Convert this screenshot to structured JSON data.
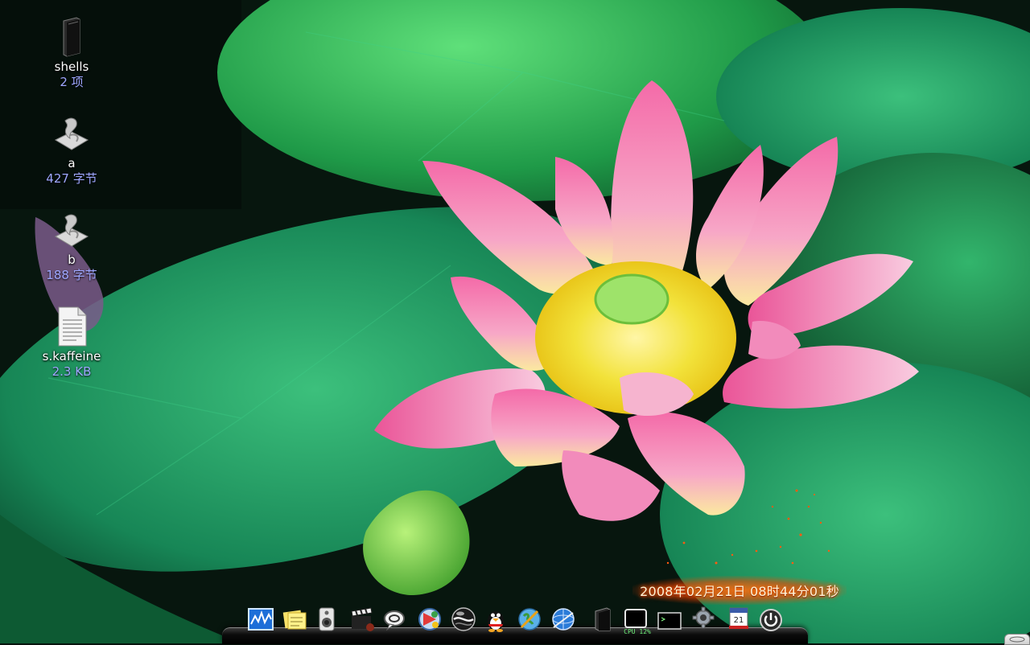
{
  "desktop": {
    "icons": [
      {
        "name": "shells",
        "meta": "2 项",
        "icon": "folder-icon"
      },
      {
        "name": "a",
        "meta": "427 字节",
        "icon": "script-icon"
      },
      {
        "name": "b",
        "meta": "188 字节",
        "icon": "script-icon"
      },
      {
        "name": "s.kaffeine",
        "meta": "2.3 KB",
        "icon": "text-file-icon"
      }
    ]
  },
  "clock": {
    "text": "2008年02月21日 08时44分01秒"
  },
  "dock": {
    "cpu_label": "CPU 12%",
    "items": [
      "system-monitor-icon",
      "sticky-notes-icon",
      "speaker-icon",
      "clapperboard-icon",
      "chat-bubble-icon",
      "media-player-icon",
      "globe-icon",
      "penguin-qq-icon",
      "web-browser-icon",
      "network-icon",
      "terminal-window-icon",
      "cpu-monitor-icon",
      "black-terminal-icon",
      "settings-gear-icon",
      "calendar-icon",
      "power-icon"
    ]
  },
  "colors": {
    "desktop_icon_meta": "#9ea6ff",
    "clock_glow": "#ff6a00",
    "leaf_green": "#1f8a4a",
    "lotus_pink": "#ea6aa6",
    "lotus_center": "#f6e83a"
  }
}
